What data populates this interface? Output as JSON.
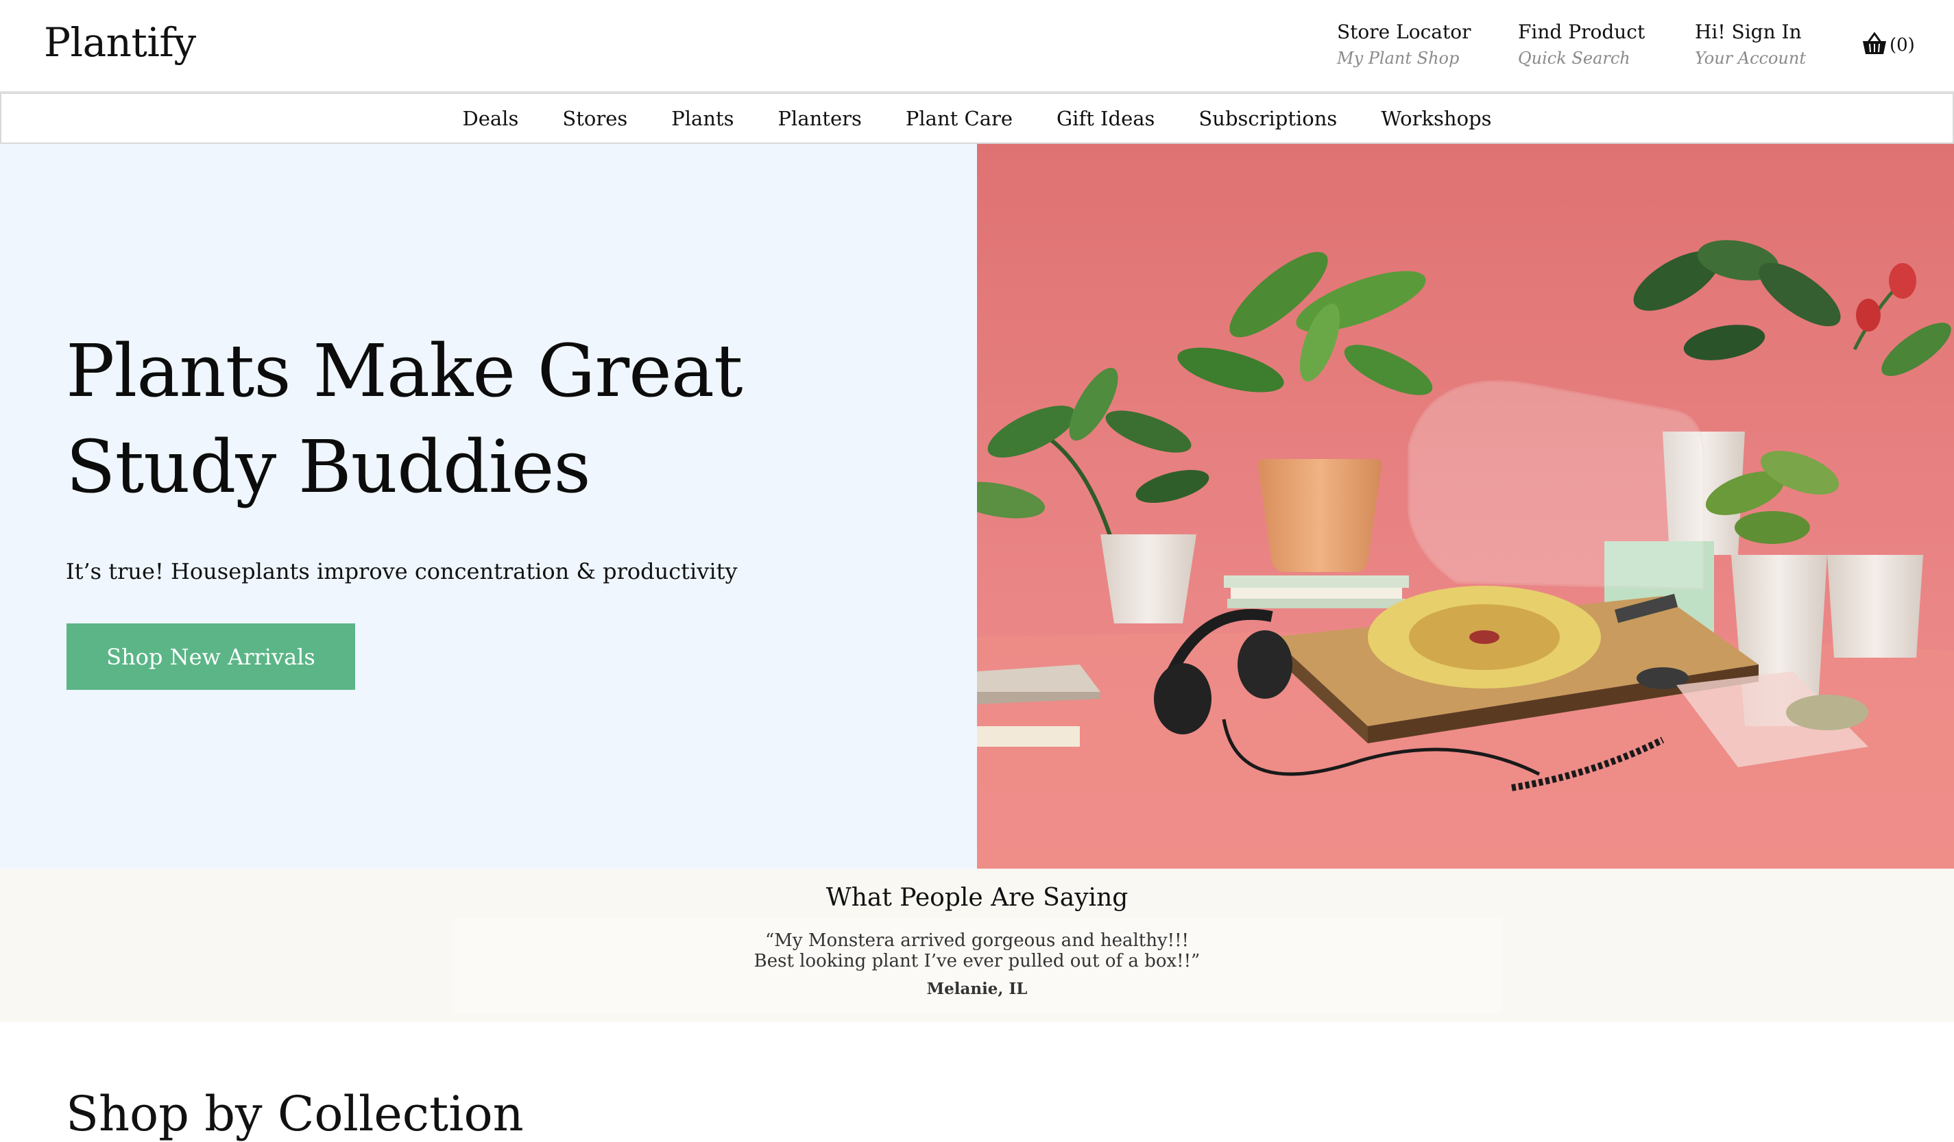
{
  "brand": {
    "name": "Plantify"
  },
  "header": {
    "store_locator": {
      "title": "Store Locator",
      "subtitle": "My Plant Shop"
    },
    "find_product": {
      "title": "Find Product",
      "subtitle": "Quick Search"
    },
    "account": {
      "title": "Hi! Sign In",
      "subtitle": "Your Account"
    },
    "cart": {
      "count": "(0)",
      "icon": "basket-icon"
    }
  },
  "nav": {
    "items": [
      {
        "label": "Deals"
      },
      {
        "label": "Stores"
      },
      {
        "label": "Plants"
      },
      {
        "label": "Planters"
      },
      {
        "label": "Plant Care"
      },
      {
        "label": "Gift Ideas"
      },
      {
        "label": "Subscriptions"
      },
      {
        "label": "Workshops"
      }
    ]
  },
  "hero": {
    "title": "Plants Make Great Study Buddies",
    "subtitle": "It’s true! Houseplants improve concentration & productivity",
    "cta": "Shop New Arrivals",
    "image": "houseplants-with-record-player-photo",
    "colors": {
      "left_bg": "#eff6fd",
      "right_bg": "#e98080",
      "cta_bg": "#5bb587"
    }
  },
  "testimonials": {
    "heading": "What People Are Saying",
    "quote_line1": "“My Monstera arrived gorgeous and healthy!!!",
    "quote_line2": "Best looking plant I’ve ever pulled out of a box!!”",
    "author": "Melanie, IL"
  },
  "collection": {
    "heading": "Shop by Collection"
  }
}
